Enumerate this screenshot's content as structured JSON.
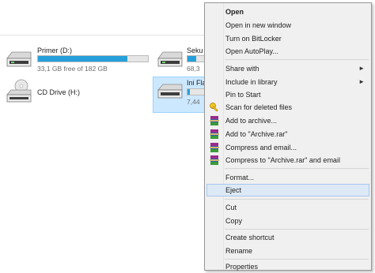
{
  "drives": [
    {
      "name": "Primer (D:)",
      "free": "33,1 GB free of 182 GB",
      "used_fraction": 0.81
    },
    {
      "name": "Seku",
      "free": "68,3",
      "used_fraction": 0.4
    },
    {
      "name": "CD Drive (H:)"
    },
    {
      "name": "Ini Fla",
      "free": "7,44",
      "used_fraction": 0.15
    }
  ],
  "context_menu": {
    "items": [
      {
        "label": "Open"
      },
      {
        "label": "Open in new window"
      },
      {
        "label": "Turn on BitLocker"
      },
      {
        "label": "Open AutoPlay..."
      },
      {
        "label": "Share with",
        "arrow": "►"
      },
      {
        "label": "Include in library",
        "arrow": "►"
      },
      {
        "label": "Pin to Start"
      },
      {
        "label": "Scan for deleted files"
      },
      {
        "label": "Add to archive..."
      },
      {
        "label": "Add to \"Archive.rar\""
      },
      {
        "label": "Compress and email..."
      },
      {
        "label": "Compress to \"Archive.rar\" and email"
      },
      {
        "label": "Format..."
      },
      {
        "label": "Eject"
      },
      {
        "label": "Cut"
      },
      {
        "label": "Copy"
      },
      {
        "label": "Create shortcut"
      },
      {
        "label": "Rename"
      },
      {
        "label": "Properties"
      }
    ]
  },
  "colors": {
    "accent_bar": "#26a0da",
    "selection": "#cce8ff",
    "menu_highlight": "#dde9f6"
  }
}
